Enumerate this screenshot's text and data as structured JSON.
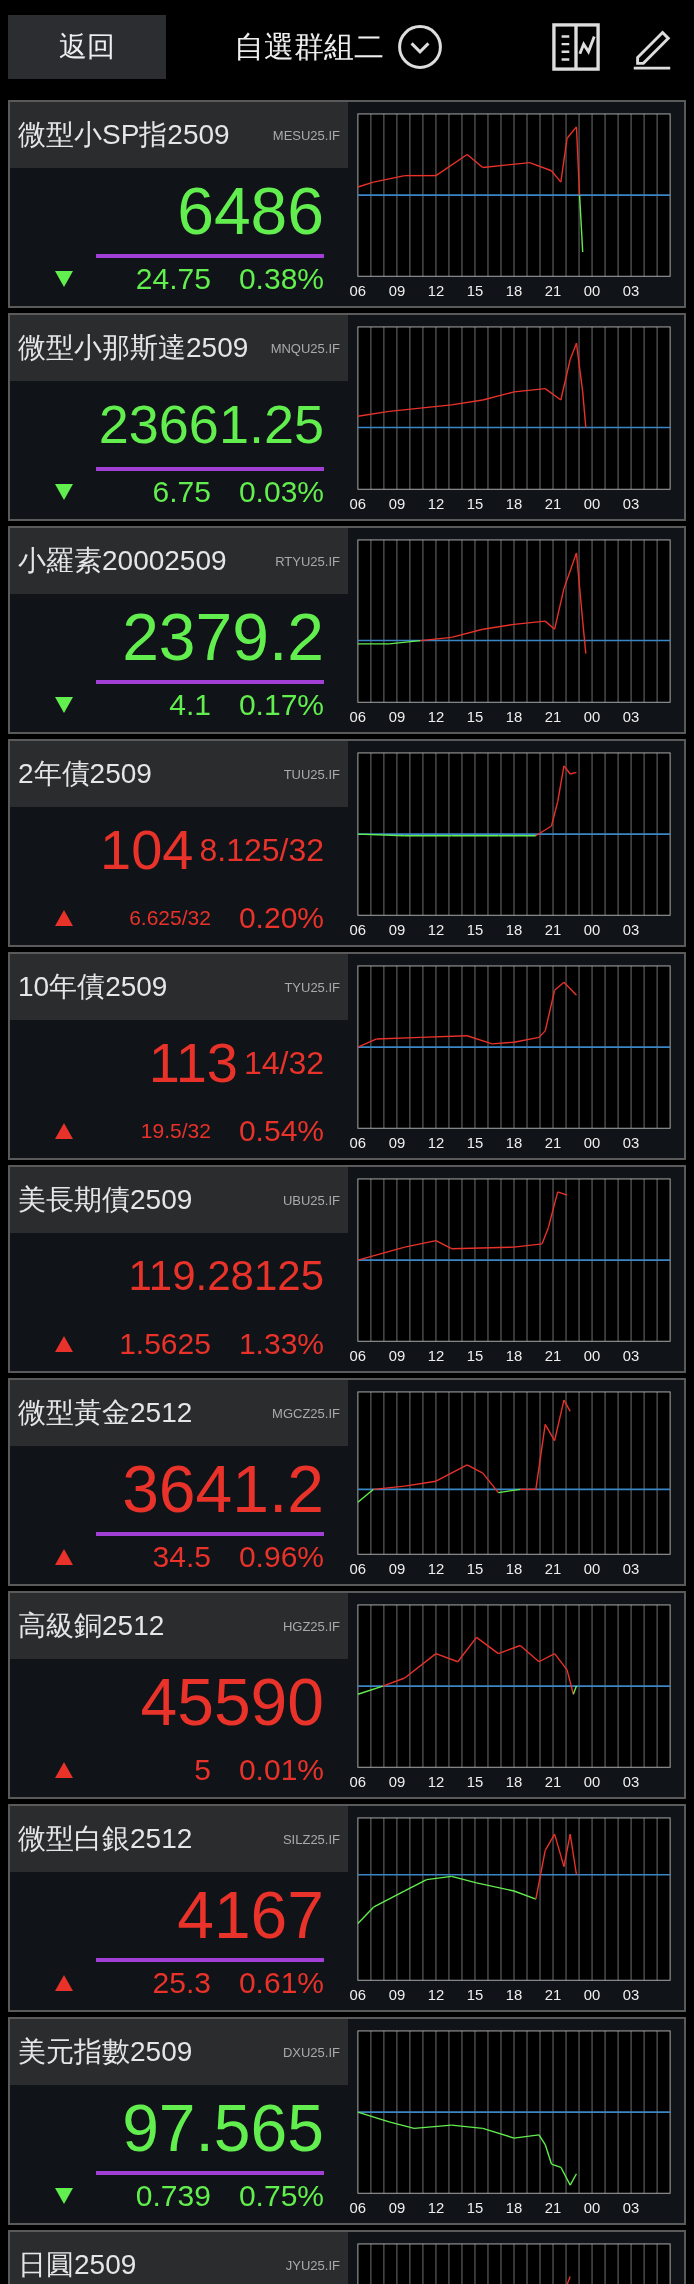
{
  "header": {
    "back_button": "返回",
    "title": "自選群組二"
  },
  "quotes": [
    {
      "name": "微型小SP指2509",
      "code": "MESU25.IF",
      "price": "6486",
      "rising": false,
      "underline": true,
      "change": "24.75",
      "percent": "0.38%",
      "axis_labels": [
        "06",
        "09",
        "12",
        "15",
        "18",
        "21",
        "00",
        "03"
      ]
    },
    {
      "name": "微型小那斯達2509",
      "code": "MNQU25.IF",
      "price": "23661.25",
      "rising": false,
      "underline": true,
      "change": "6.75",
      "percent": "0.03%",
      "axis_labels": [
        "06",
        "09",
        "12",
        "15",
        "18",
        "21",
        "00",
        "03"
      ]
    },
    {
      "name": "小羅素20002509",
      "code": "RTYU25.IF",
      "price": "2379.2",
      "rising": false,
      "underline": true,
      "change": "4.1",
      "percent": "0.17%",
      "axis_labels": [
        "06",
        "09",
        "12",
        "15",
        "18",
        "21",
        "00",
        "03"
      ]
    },
    {
      "name": "2年債2509",
      "code": "TUU25.IF",
      "price": "104",
      "price_fraction": "8.125/32",
      "rising": true,
      "underline": false,
      "change": "6.625/32",
      "percent": "0.20%",
      "axis_labels": [
        "06",
        "09",
        "12",
        "15",
        "18",
        "21",
        "00",
        "03"
      ]
    },
    {
      "name": "10年債2509",
      "code": "TYU25.IF",
      "price": "113",
      "price_fraction": "14/32",
      "rising": true,
      "underline": false,
      "change": "19.5/32",
      "percent": "0.54%",
      "axis_labels": [
        "06",
        "09",
        "12",
        "15",
        "18",
        "21",
        "00",
        "03"
      ]
    },
    {
      "name": "美長期債2509",
      "code": "UBU25.IF",
      "price": "119.28125",
      "rising": true,
      "underline": false,
      "change": "1.5625",
      "percent": "1.33%",
      "axis_labels": [
        "06",
        "09",
        "12",
        "15",
        "18",
        "21",
        "00",
        "03"
      ]
    },
    {
      "name": "微型黃金2512",
      "code": "MGCZ25.IF",
      "price": "3641.2",
      "rising": true,
      "underline": true,
      "change": "34.5",
      "percent": "0.96%",
      "axis_labels": [
        "06",
        "09",
        "12",
        "15",
        "18",
        "21",
        "00",
        "03"
      ]
    },
    {
      "name": "高級銅2512",
      "code": "HGZ25.IF",
      "price": "45590",
      "rising": true,
      "underline": false,
      "change": "5",
      "percent": "0.01%",
      "axis_labels": [
        "06",
        "09",
        "12",
        "15",
        "18",
        "21",
        "00",
        "03"
      ]
    },
    {
      "name": "微型白銀2512",
      "code": "SILZ25.IF",
      "price": "4167",
      "rising": true,
      "underline": true,
      "change": "25.3",
      "percent": "0.61%",
      "axis_labels": [
        "06",
        "09",
        "12",
        "15",
        "18",
        "21",
        "00",
        "03"
      ]
    },
    {
      "name": "美元指數2509",
      "code": "DXU25.IF",
      "price": "97.565",
      "rising": false,
      "underline": true,
      "change": "0.739",
      "percent": "0.75%",
      "axis_labels": [
        "06",
        "09",
        "12",
        "15",
        "18",
        "21",
        "00",
        "03"
      ]
    },
    {
      "name": "日圓2509",
      "code": "JYU25.IF"
    }
  ]
}
